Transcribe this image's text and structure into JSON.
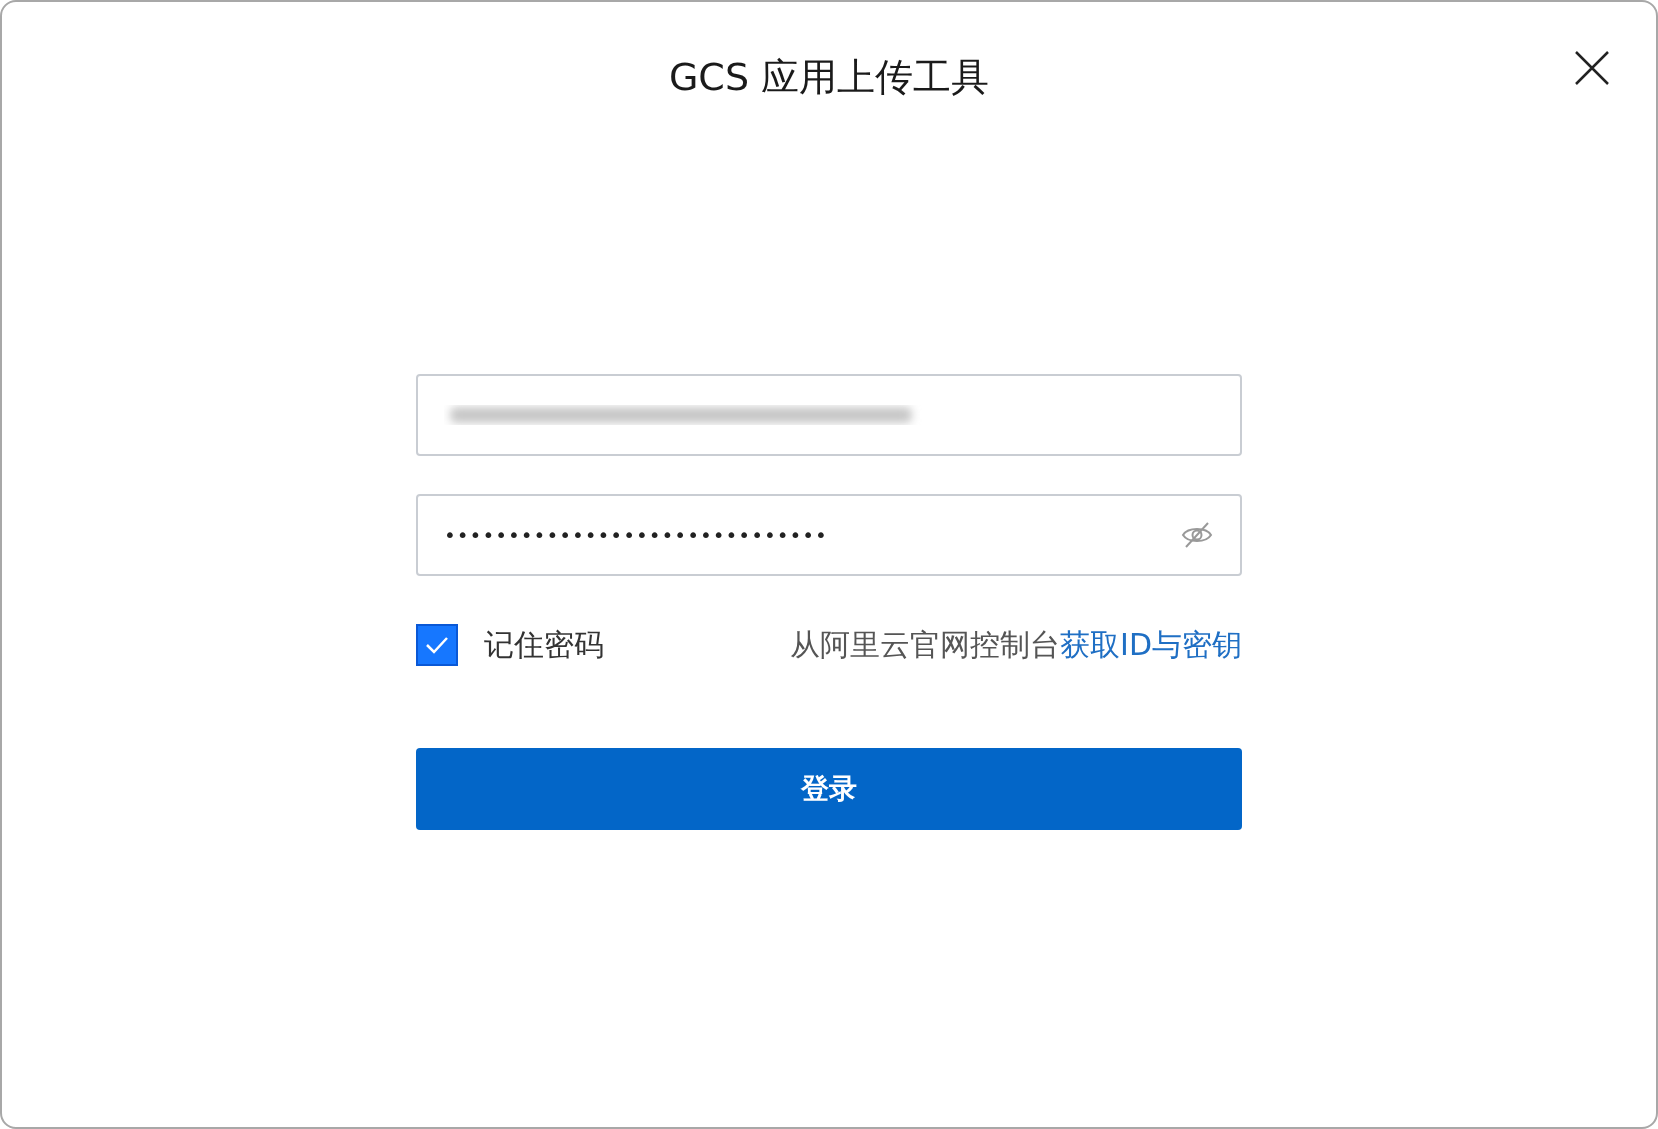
{
  "window": {
    "title": "GCS 应用上传工具"
  },
  "access_key_field": {
    "redacted": true
  },
  "password_field": {
    "value": "••••••••••••••••••••••••••••••",
    "visible": false
  },
  "remember": {
    "label": "记住密码",
    "checked": true
  },
  "hint": {
    "text": "从阿里云官网控制台",
    "link": "获取ID与密钥"
  },
  "login_button": {
    "label": "登录"
  }
}
